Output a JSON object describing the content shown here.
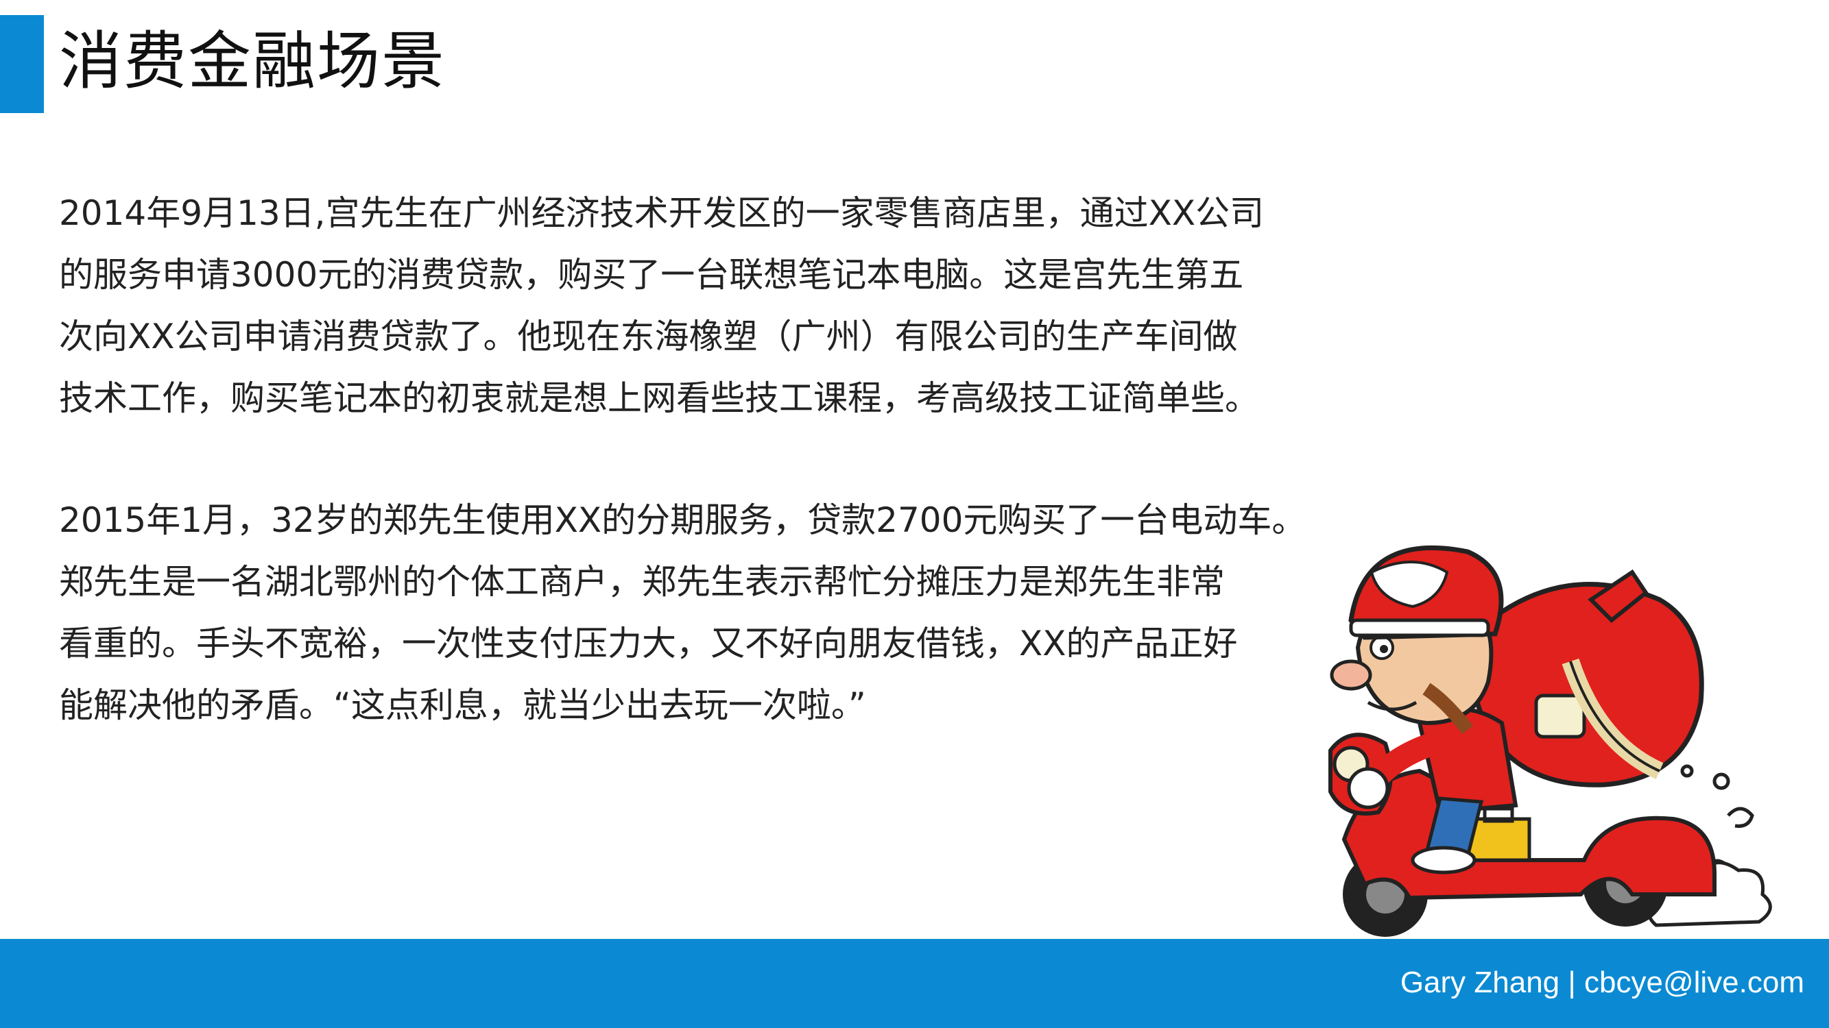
{
  "slide": {
    "title": "消费金融场景",
    "paragraphs": [
      {
        "lines": [
          "2014年9月13日,宫先生在广州经济技术开发区的一家零售商店里，通过XX公司",
          "的服务申请3000元的消费贷款，购买了一台联想笔记本电脑。这是宫先生第五",
          "次向XX公司申请消费贷款了。他现在东海橡塑（广州）有限公司的生产车间做",
          "技术工作，购买笔记本的初衷就是想上网看些技工课程，考高级技工证简单些。"
        ]
      },
      {
        "lines": [
          "2015年1月，32岁的郑先生使用XX的分期服务，贷款2700元购买了一台电动车。",
          "郑先生是一名湖北鄂州的个体工商户，郑先生表示帮忙分摊压力是郑先生非常",
          "看重的。手头不宽裕，一次性支付压力大，又不好向朋友借钱，XX的产品正好",
          "能解决他的矛盾。“这点利息，就当少出去玩一次啦。”"
        ]
      }
    ],
    "illustration": "cartoon-delivery-scooter-rider",
    "footer": "Gary Zhang | cbcye@live.com"
  },
  "colors": {
    "accent": "#0b8ad3",
    "scooter_red": "#e0211d",
    "text": "#222222"
  }
}
